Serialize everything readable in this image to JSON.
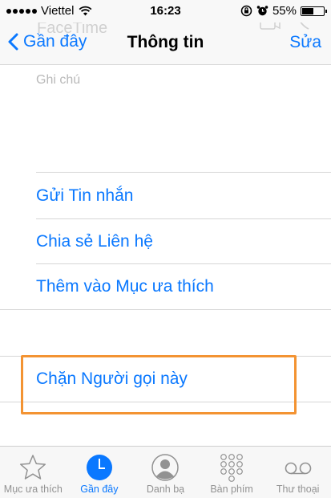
{
  "status_bar": {
    "carrier": "Viettel",
    "time": "16:23",
    "battery": "55%",
    "battery_level": 0.55
  },
  "nav": {
    "back_label": "Gần đây",
    "title": "Thông tin",
    "edit_label": "Sửa",
    "ghost_title": "FaceTime"
  },
  "notes": {
    "label": "Ghi chú"
  },
  "actions": [
    {
      "label": "Gửi Tin nhắn"
    },
    {
      "label": "Chia sẻ Liên hệ"
    },
    {
      "label": "Thêm vào Mục ưa thích"
    }
  ],
  "block": {
    "label": "Chặn Người gọi này",
    "highlight_color": "#f39332"
  },
  "tabs": [
    {
      "label": "Mục ưa thích",
      "icon": "star-icon"
    },
    {
      "label": "Gần đây",
      "icon": "clock-icon",
      "active": true
    },
    {
      "label": "Danh bạ",
      "icon": "contacts-icon"
    },
    {
      "label": "Bàn phím",
      "icon": "keypad-icon"
    },
    {
      "label": "Thư thoại",
      "icon": "voicemail-icon"
    }
  ],
  "colors": {
    "accent": "#0a78ff",
    "inactive": "#929292"
  }
}
